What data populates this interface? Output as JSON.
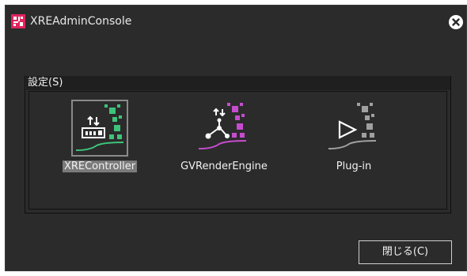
{
  "window": {
    "title": "XREAdminConsole"
  },
  "group": {
    "label": "設定(S)"
  },
  "tiles": [
    {
      "label": "XREController",
      "selected": true,
      "color": "#3ec47a"
    },
    {
      "label": "GVRenderEngine",
      "selected": false,
      "color": "#c64ccf"
    },
    {
      "label": "Plug-in",
      "selected": false,
      "color": "#a0a0a0"
    }
  ],
  "footer": {
    "close_label": "閉じる(C)"
  },
  "colors": {
    "background": "#2b2b2b",
    "accent_green": "#3ec47a",
    "accent_purple": "#c64ccf",
    "accent_gray": "#a0a0a0"
  }
}
